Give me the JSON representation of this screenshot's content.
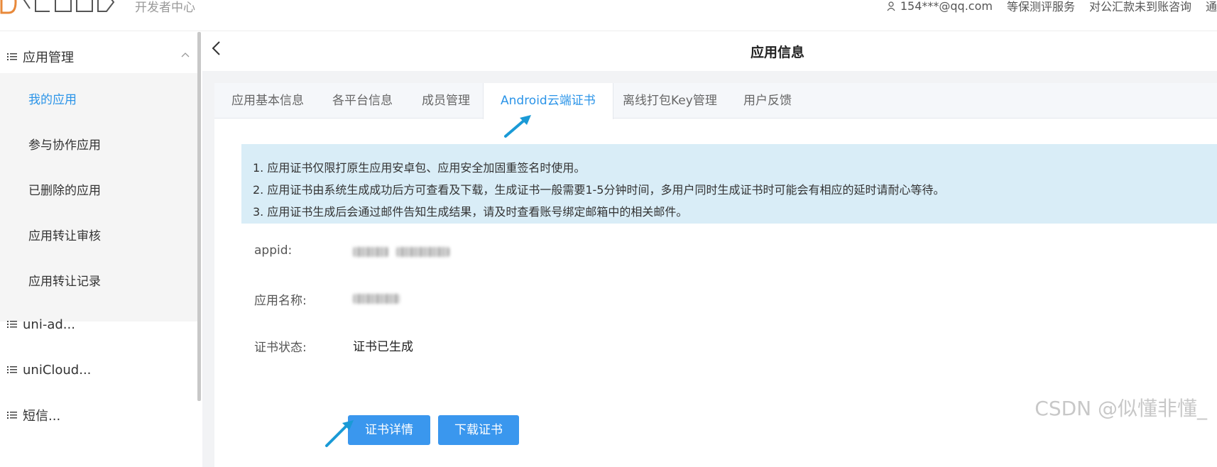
{
  "header": {
    "brand_sub": "开发者中心",
    "user_email": "154***@qq.com",
    "links": [
      "等保测评服务",
      "对公汇款未到账咨询",
      "通"
    ]
  },
  "sidebar": {
    "groups": [
      {
        "label": "应用管理"
      },
      {
        "label": "uni-ad..."
      },
      {
        "label": "uniCloud..."
      },
      {
        "label": "短信..."
      }
    ],
    "items": [
      {
        "label": "我的应用",
        "active": true
      },
      {
        "label": "参与协作应用"
      },
      {
        "label": "已删除的应用"
      },
      {
        "label": "应用转让审核"
      },
      {
        "label": "应用转让记录"
      }
    ]
  },
  "main": {
    "title": "应用信息",
    "tabs": [
      {
        "label": "应用基本信息"
      },
      {
        "label": "各平台信息"
      },
      {
        "label": "成员管理"
      },
      {
        "label": "Android云端证书",
        "active": true
      },
      {
        "label": "离线打包Key管理"
      },
      {
        "label": "用户反馈"
      }
    ],
    "notice": [
      "1. 应用证书仅限打原生应用安卓包、应用安全加固重签名时使用。",
      "2. 应用证书由系统生成成功后方可查看及下载，生成证书一般需要1-5分钟时间，多用户同时生成证书时可能会有相应的延时请耐心等待。",
      "3. 应用证书生成后会通过邮件告知生成结果，请及时查看账号绑定邮箱中的相关邮件。"
    ],
    "fields": {
      "appid_label": "appid:",
      "name_label": "应用名称:",
      "status_label": "证书状态:",
      "status_value": "证书已生成"
    },
    "buttons": {
      "detail": "证书详情",
      "download": "下载证书"
    }
  },
  "watermark": "CSDN @似懂非懂_",
  "colors": {
    "accent": "#2b94e8",
    "button": "#3a97ee",
    "notice_bg": "#d9edf7",
    "arrow": "#1a9ad6"
  }
}
